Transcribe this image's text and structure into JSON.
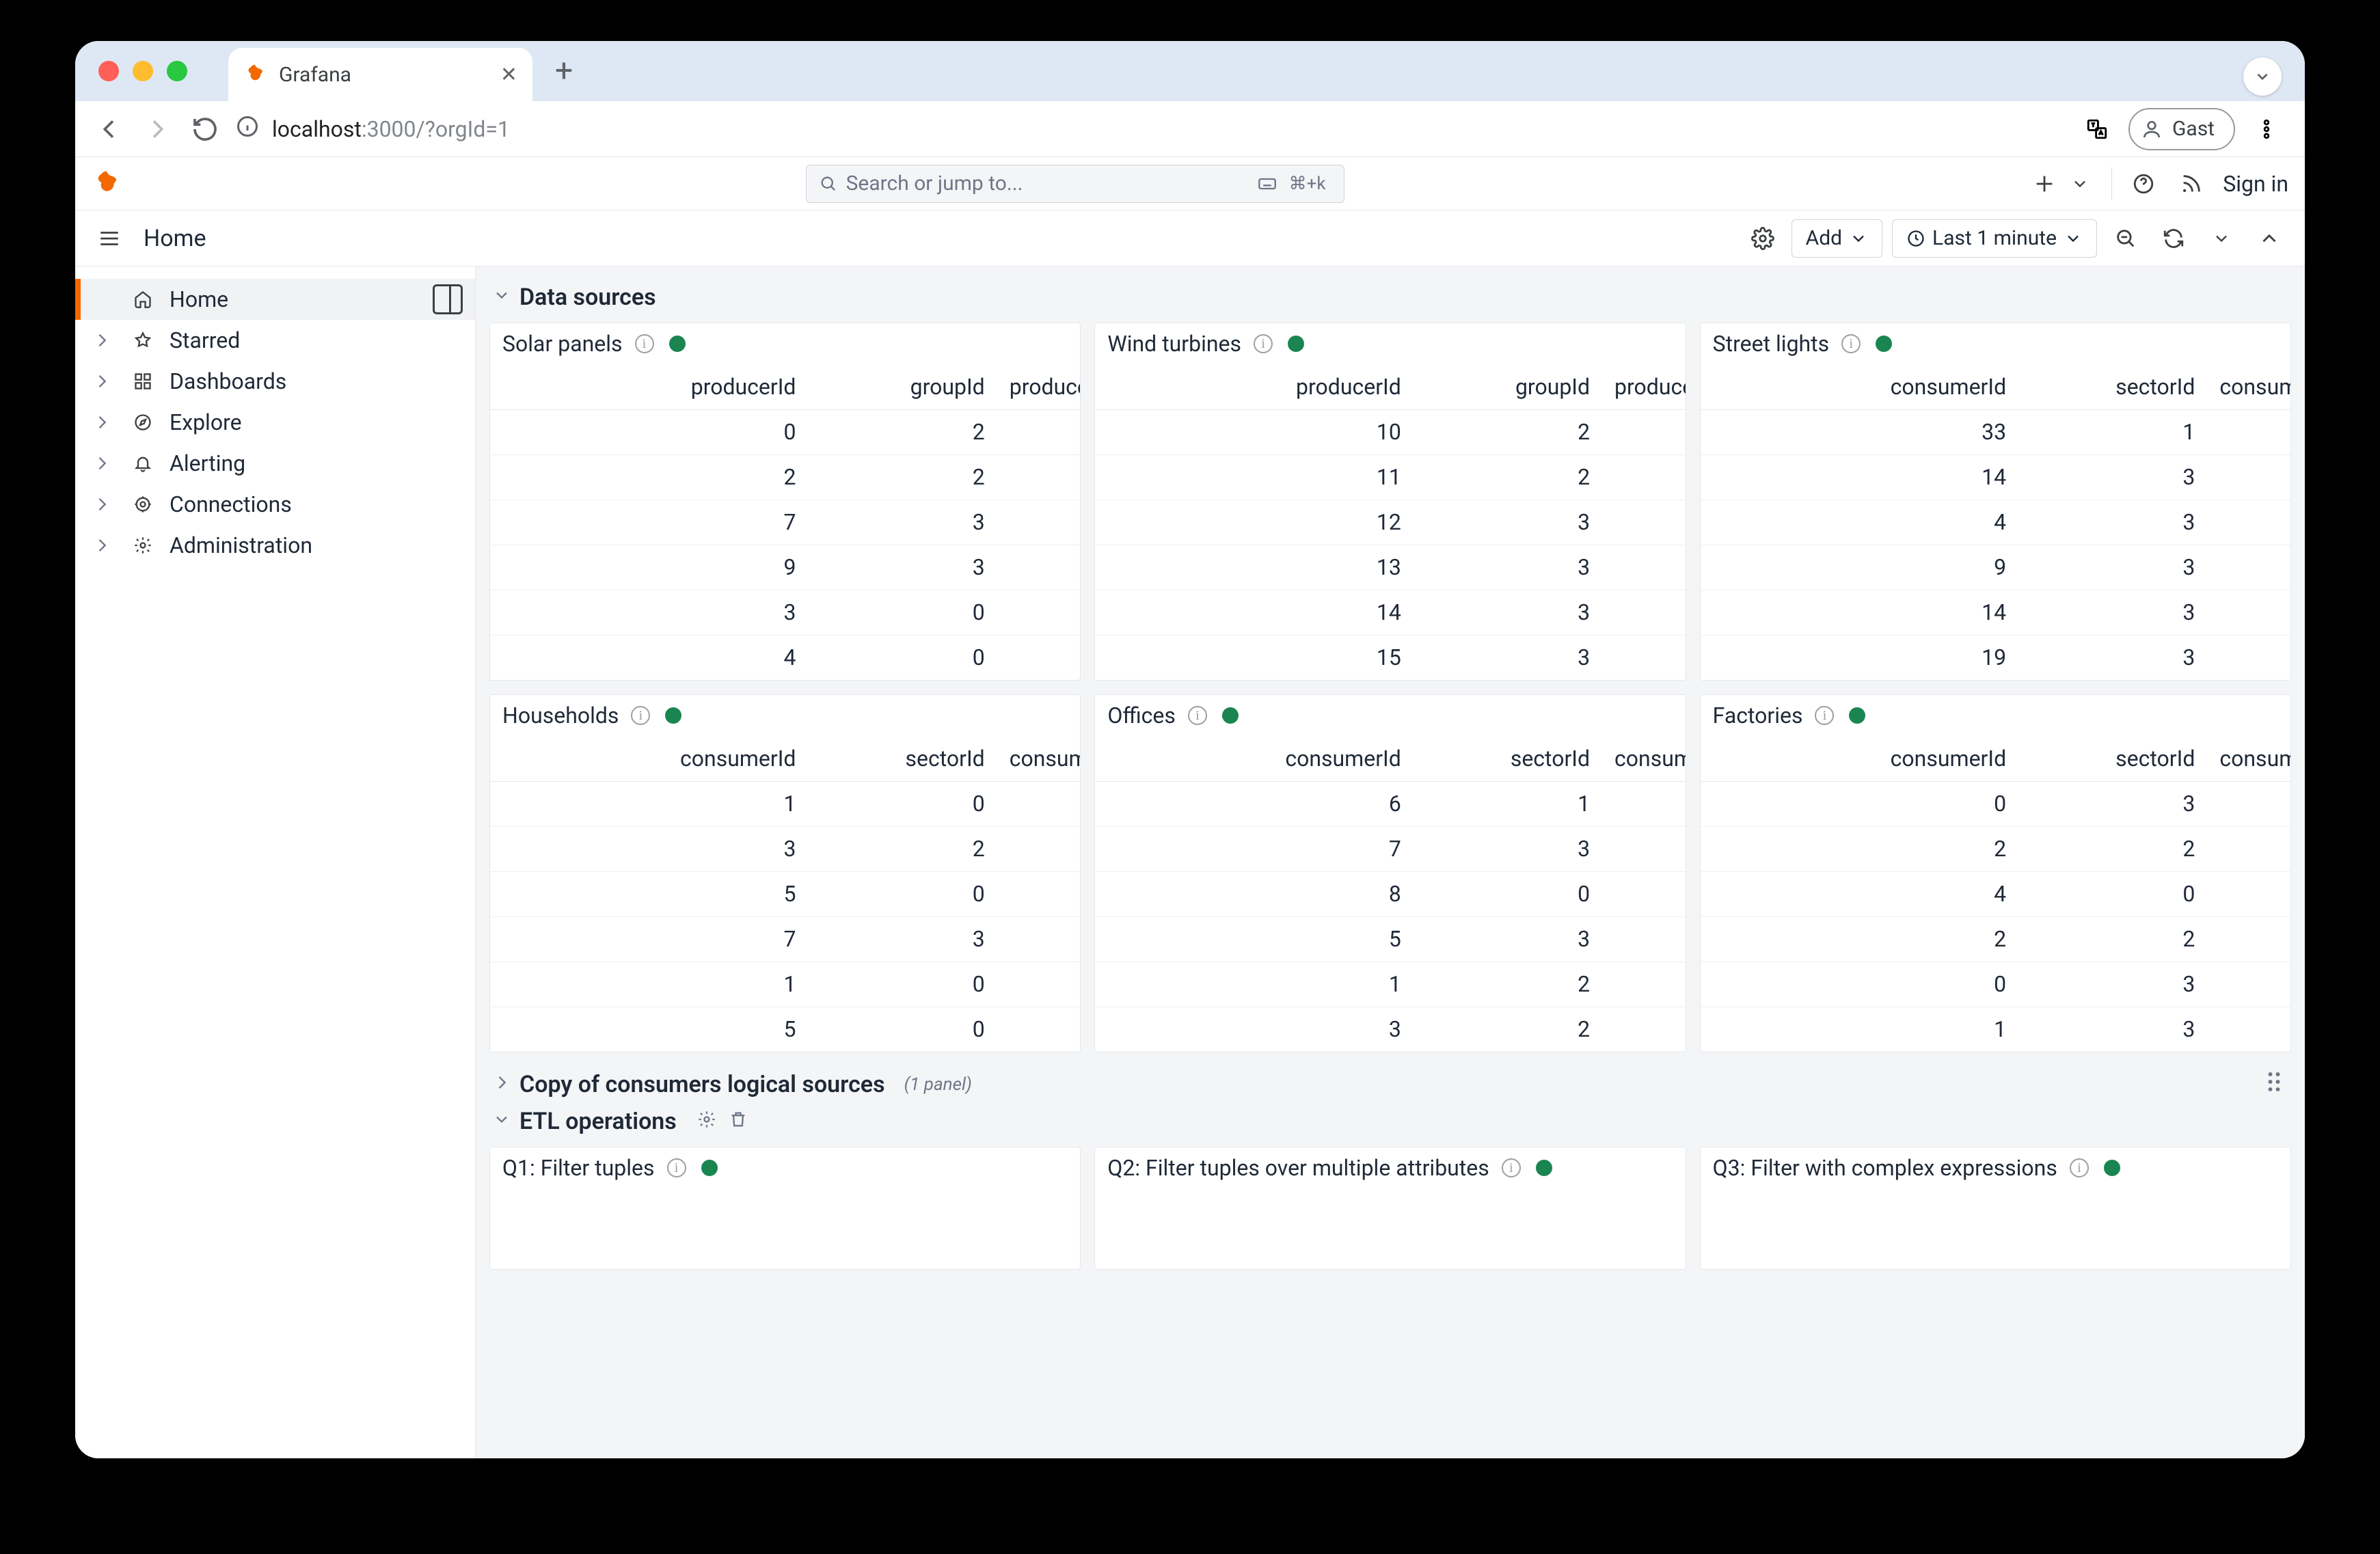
{
  "browser": {
    "tab_title": "Grafana",
    "url_host": "localhost",
    "url_path": ":3000/?orgId=1",
    "guest_label": "Gast"
  },
  "topbar": {
    "search_placeholder": "Search or jump to...",
    "kbd_hint_1": "⌘+k",
    "sign_in": "Sign in"
  },
  "toolbar": {
    "breadcrumb": "Home",
    "add_label": "Add",
    "time_label": "Last 1 minute"
  },
  "sidebar": {
    "items": [
      {
        "label": "Home",
        "active": true,
        "expandable": false,
        "icon": "home",
        "dock": true
      },
      {
        "label": "Starred",
        "active": false,
        "expandable": true,
        "icon": "star"
      },
      {
        "label": "Dashboards",
        "active": false,
        "expandable": true,
        "icon": "grid"
      },
      {
        "label": "Explore",
        "active": false,
        "expandable": true,
        "icon": "compass"
      },
      {
        "label": "Alerting",
        "active": false,
        "expandable": true,
        "icon": "bell"
      },
      {
        "label": "Connections",
        "active": false,
        "expandable": true,
        "icon": "plug"
      },
      {
        "label": "Administration",
        "active": false,
        "expandable": true,
        "icon": "gear"
      }
    ]
  },
  "rows": [
    {
      "title": "Data sources",
      "expanded": true,
      "panels": [
        {
          "title": "Solar panels",
          "columns": [
            "producerId",
            "groupId",
            "producedPo"
          ],
          "data": [
            [
              0,
              2
            ],
            [
              2,
              2
            ],
            [
              7,
              3
            ],
            [
              9,
              3
            ],
            [
              3,
              0
            ],
            [
              4,
              0
            ]
          ]
        },
        {
          "title": "Wind turbines",
          "columns": [
            "producerId",
            "groupId",
            "producedPo"
          ],
          "data": [
            [
              10,
              2
            ],
            [
              11,
              2
            ],
            [
              12,
              3
            ],
            [
              13,
              3
            ],
            [
              14,
              3
            ],
            [
              15,
              3
            ]
          ]
        },
        {
          "title": "Street lights",
          "columns": [
            "consumerId",
            "sectorId",
            "consumedPo"
          ],
          "data": [
            [
              33,
              1
            ],
            [
              14,
              3
            ],
            [
              4,
              3
            ],
            [
              9,
              3
            ],
            [
              14,
              3
            ],
            [
              19,
              3
            ]
          ]
        },
        {
          "title": "Households",
          "columns": [
            "consumerId",
            "sectorId",
            "consumedPo"
          ],
          "data": [
            [
              1,
              0
            ],
            [
              3,
              2
            ],
            [
              5,
              0
            ],
            [
              7,
              3
            ],
            [
              1,
              0
            ],
            [
              5,
              0
            ]
          ]
        },
        {
          "title": "Offices",
          "columns": [
            "consumerId",
            "sectorId",
            "consumedPo"
          ],
          "data": [
            [
              6,
              1
            ],
            [
              7,
              3
            ],
            [
              8,
              0
            ],
            [
              5,
              3
            ],
            [
              1,
              2
            ],
            [
              3,
              2
            ]
          ]
        },
        {
          "title": "Factories",
          "columns": [
            "consumerId",
            "sectorId",
            "consumedPo"
          ],
          "data": [
            [
              0,
              3
            ],
            [
              2,
              2
            ],
            [
              4,
              0
            ],
            [
              2,
              2
            ],
            [
              0,
              3
            ],
            [
              1,
              3
            ]
          ]
        }
      ]
    },
    {
      "title": "Copy of consumers logical sources",
      "expanded": false,
      "meta": "(1 panel)"
    },
    {
      "title": "ETL operations",
      "expanded": true,
      "actions": true,
      "panels": [
        {
          "title": "Q1: Filter tuples",
          "empty": true
        },
        {
          "title": "Q2: Filter tuples over multiple attributes",
          "empty": true
        },
        {
          "title": "Q3: Filter with complex expressions",
          "empty": true,
          "info": true
        }
      ]
    }
  ]
}
